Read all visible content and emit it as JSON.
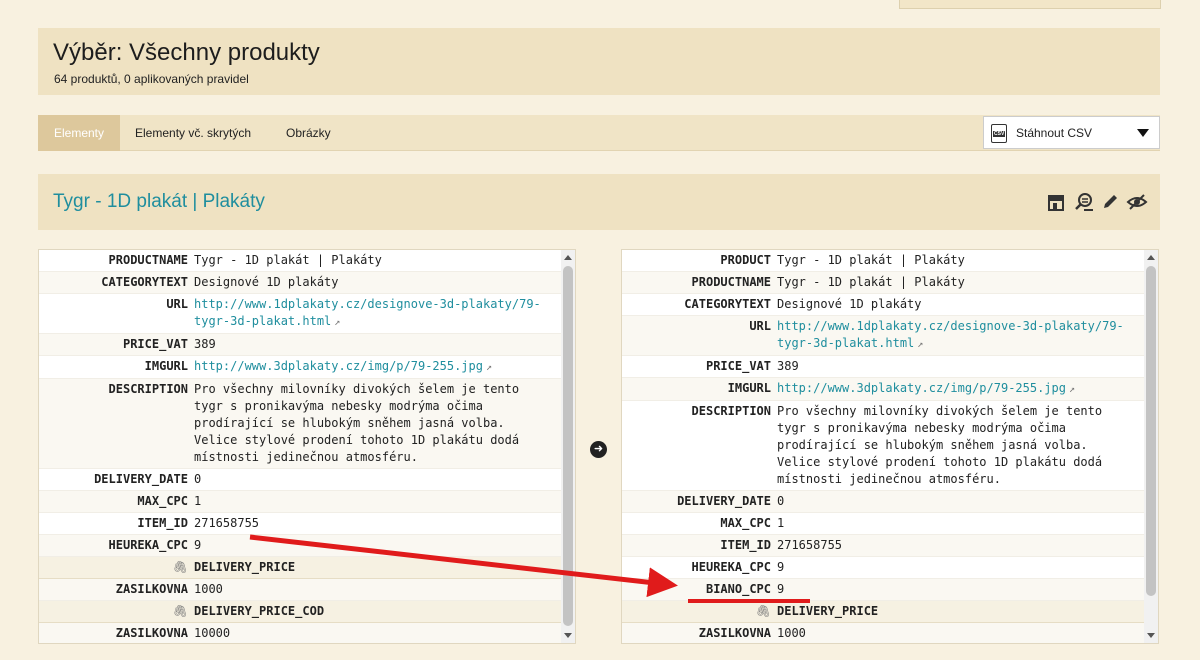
{
  "header": {
    "title": "Výběr: Všechny produkty",
    "subtitle": "64 produktů, 0 aplikovaných pravidel"
  },
  "tabs": [
    {
      "label": "Elementy",
      "active": true
    },
    {
      "label": "Elementy vč. skrytých",
      "active": false
    },
    {
      "label": "Obrázky",
      "active": false
    }
  ],
  "download": {
    "label": "Stáhnout CSV",
    "icon": "csv-file-icon",
    "badge": "CSV"
  },
  "product": {
    "title": "Tygr - 1D plakát | Plakáty",
    "actions": [
      "shop-icon",
      "search-settings-icon",
      "pencil-icon",
      "hide-eye-icon"
    ]
  },
  "left_rows": [
    {
      "k": "PRODUCTNAME",
      "v": "Tygr - 1D plakát | Plakáty"
    },
    {
      "k": "CATEGORYTEXT",
      "v": "Designové 1D plakáty"
    },
    {
      "k": "URL",
      "v": "http://www.1dplakaty.cz/designove-3d-plakaty/79-tygr-3d-plakat.html",
      "link": true
    },
    {
      "k": "PRICE_VAT",
      "v": "389"
    },
    {
      "k": "IMGURL",
      "v": "http://www.3dplakaty.cz/img/p/79-255.jpg",
      "link": true
    },
    {
      "k": "DESCRIPTION",
      "v": "Pro všechny milovníky divokých šelem je tento tygr s pronikavýma nebesky modrýma očima prodírající se hlubokým sněhem jasná volba. Velice stylové prodení tohoto 1D plakátu dodá místnosti jedinečnou atmosféru."
    },
    {
      "k": "DELIVERY_DATE",
      "v": "0"
    },
    {
      "k": "MAX_CPC",
      "v": "1"
    },
    {
      "k": "ITEM_ID",
      "v": "271658755"
    },
    {
      "k": "HEUREKA_CPC",
      "v": "9"
    },
    {
      "k": "",
      "v": "DELIVERY_PRICE",
      "cat": true
    },
    {
      "k": "ZASILKOVNA",
      "v": "1000"
    },
    {
      "k": "",
      "v": "DELIVERY_PRICE_COD",
      "cat": true
    },
    {
      "k": "ZASILKOVNA",
      "v": "10000"
    }
  ],
  "right_rows": [
    {
      "k": "PRODUCT",
      "v": "Tygr - 1D plakát | Plakáty"
    },
    {
      "k": "PRODUCTNAME",
      "v": "Tygr - 1D plakát | Plakáty"
    },
    {
      "k": "CATEGORYTEXT",
      "v": "Designové 1D plakáty"
    },
    {
      "k": "URL",
      "v": "http://www.1dplakaty.cz/designove-3d-plakaty/79-tygr-3d-plakat.html",
      "link": true
    },
    {
      "k": "PRICE_VAT",
      "v": "389"
    },
    {
      "k": "IMGURL",
      "v": "http://www.3dplakaty.cz/img/p/79-255.jpg",
      "link": true
    },
    {
      "k": "DESCRIPTION",
      "v": "Pro všechny milovníky divokých šelem je tento tygr s pronikavýma nebesky modrýma očima prodírající se hlubokým sněhem jasná volba. Velice stylové prodení tohoto 1D plakátu dodá místnosti jedinečnou atmosféru."
    },
    {
      "k": "DELIVERY_DATE",
      "v": "0"
    },
    {
      "k": "MAX_CPC",
      "v": "1"
    },
    {
      "k": "ITEM_ID",
      "v": "271658755"
    },
    {
      "k": "HEUREKA_CPC",
      "v": "9"
    },
    {
      "k": "BIANO_CPC",
      "v": "9"
    },
    {
      "k": "",
      "v": "DELIVERY_PRICE",
      "cat": true
    },
    {
      "k": "ZASILKOVNA",
      "v": "1000"
    }
  ],
  "colors": {
    "accent": "#1f8e9e",
    "annotation": "#e01b1b",
    "tab_active": "#ddc89c"
  }
}
